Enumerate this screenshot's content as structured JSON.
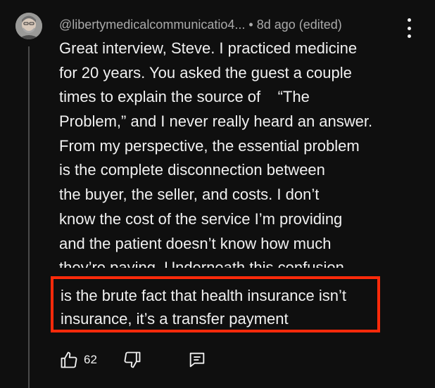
{
  "comment": {
    "author": "@libertymedicalcommunicatio4...",
    "separator": "•",
    "time": "8d ago (edited)",
    "text_lines": [
      "Great interview, Steve. I practiced medicine",
      "for 20 years. You asked the guest a couple",
      "times to explain the source of    “The",
      "Problem,” and I never really heard an answer.",
      "From my perspective, the essential problem",
      "is the complete disconnection between",
      "the buyer, the seller, and costs. I don’t",
      "know the cost of the service I’m providing",
      "and the patient doesn’t know how much",
      "they’re paying. Underneath this confusion"
    ],
    "highlighted_lines": [
      "is the brute fact that health insurance isn’t",
      "insurance, it’s a transfer payment"
    ],
    "likes": "62"
  },
  "icons": {
    "avatar": "user-avatar",
    "more": "more-vert-icon",
    "like": "thumbs-up-icon",
    "dislike": "thumbs-down-icon",
    "reply": "reply-comment-icon"
  },
  "colors": {
    "background": "#0f0f0f",
    "text": "#f1f1f1",
    "meta": "#aaaaaa",
    "highlight_border": "#ff2a0a"
  }
}
